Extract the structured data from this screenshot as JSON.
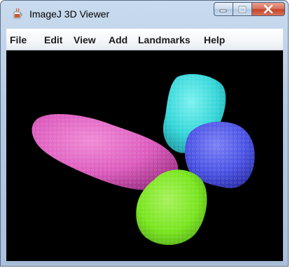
{
  "window": {
    "title": "ImageJ 3D Viewer",
    "app_icon": "imagej-cup-icon",
    "buttons": {
      "minimize_icon": "minimize-icon",
      "maximize_icon": "maximize-icon",
      "close_icon": "close-icon"
    }
  },
  "menubar": {
    "items": [
      {
        "label": "File"
      },
      {
        "label": "Edit"
      },
      {
        "label": "View"
      },
      {
        "label": "Add"
      },
      {
        "label": "Landmarks"
      },
      {
        "label": "Help"
      }
    ]
  },
  "viewport": {
    "background": "#000000",
    "objects": [
      {
        "name": "magenta-object",
        "color": "#e05bbd"
      },
      {
        "name": "cyan-object",
        "color": "#35dcdc"
      },
      {
        "name": "blue-object",
        "color": "#4a52e6"
      },
      {
        "name": "green-object",
        "color": "#79e81c"
      }
    ]
  }
}
